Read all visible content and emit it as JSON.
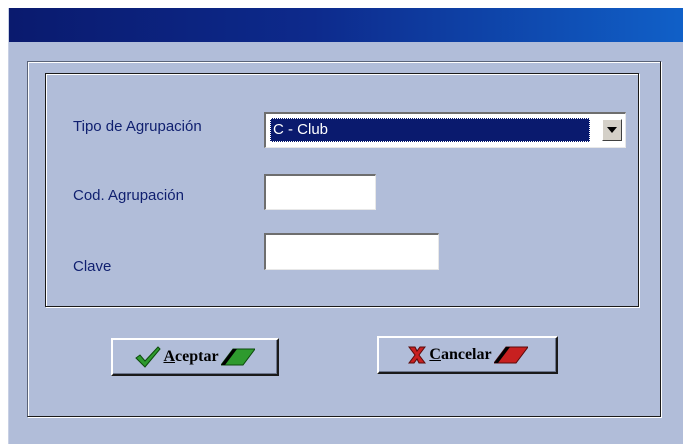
{
  "colors": {
    "window_bg": "#b1bdd9",
    "titlebar": "#0d2a8c",
    "label_text": "#0f1f6f",
    "selection_bg": "#0a1a6e",
    "ok_icon": "#2e9a2e",
    "cancel_icon": "#c82020"
  },
  "form": {
    "tipo_label": "Tipo de Agrupación",
    "tipo_value": "C - Club",
    "cod_label": "Cod. Agrupación",
    "cod_value": "",
    "clave_label": "Clave",
    "clave_value": ""
  },
  "buttons": {
    "accept": {
      "first": "A",
      "rest": "ceptar",
      "icon": "checkmark-icon"
    },
    "cancel": {
      "first": "C",
      "rest": "ancelar",
      "icon": "x-mark-icon"
    }
  }
}
